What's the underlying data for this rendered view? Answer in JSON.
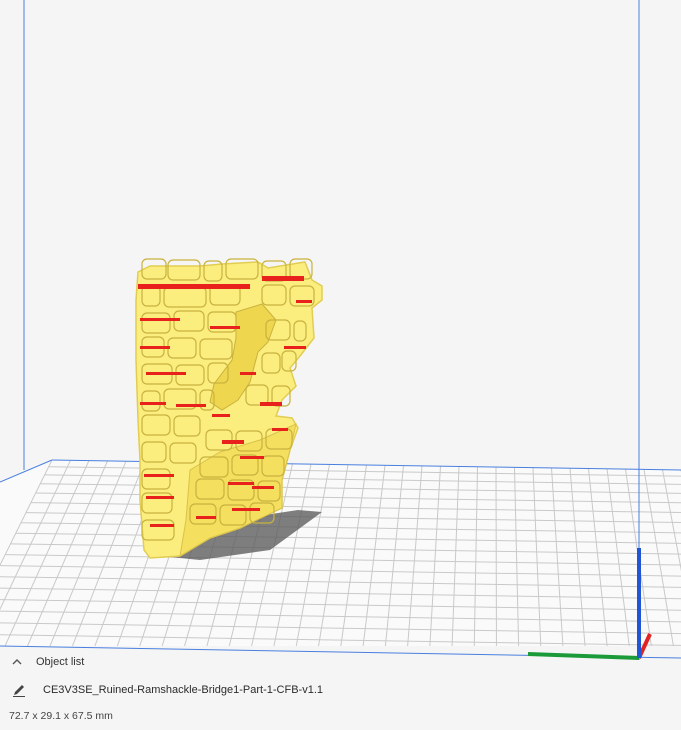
{
  "object_list": {
    "header_label": "Object list",
    "expand_icon": "chevron-up-icon"
  },
  "object": {
    "name": "CE3V3SE_Ruined-Ramshackle-Bridge1-Part-1-CFB-v1.1",
    "edit_icon": "pencil-icon",
    "dimensions": "72.7 x 29.1 x 67.5 mm"
  },
  "colors": {
    "background": "#f5f5f5",
    "build_volume_outline": "#4a7fe0",
    "grid_line": "#c9c9c9",
    "model_fill": "#fbee7e",
    "model_overhang": "#e8211c",
    "axis_x": "#1b9a3a",
    "axis_y": "#e02424",
    "axis_z": "#1f56d6"
  }
}
